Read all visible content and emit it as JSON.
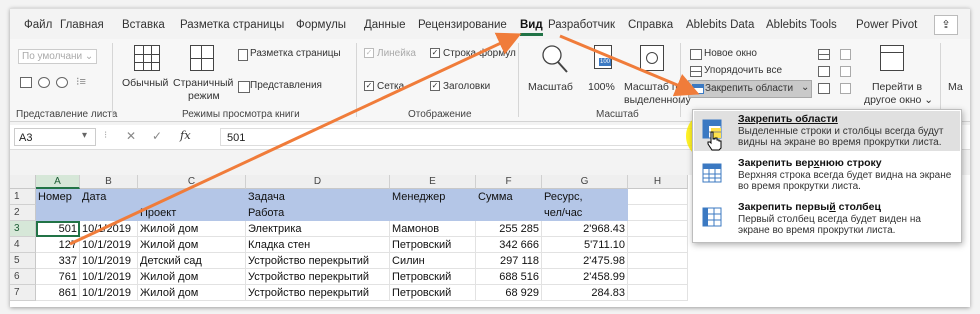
{
  "tabs": [
    "Файл",
    "Главная",
    "Вставка",
    "Разметка страницы",
    "Формулы",
    "Данные",
    "Рецензирование",
    "Вид",
    "Разработчик",
    "Справка",
    "Ablebits Data",
    "Ablebits Tools",
    "Power Pivot"
  ],
  "active_tab": "Вид",
  "ribbon": {
    "sheet_view": {
      "default_label": "По умолчани",
      "group_label": "Представление листа"
    },
    "workbook_views": {
      "normal": "Обычный",
      "page_mode_1": "Страничный",
      "page_mode_2": "режим",
      "page_layout": "Разметка страницы",
      "custom_views": "Представления",
      "group_label": "Режимы просмотра книги"
    },
    "show": {
      "ruler": "Линейка",
      "formula_bar": "Строка формул",
      "gridlines": "Сетка",
      "headings": "Заголовки",
      "group_label": "Отображение"
    },
    "zoom": {
      "zoom": "Масштаб",
      "zoom_100": "100%",
      "zoom_sel_1": "Масштаб по",
      "zoom_sel_2": "выделенному",
      "group_label": "Масштаб"
    },
    "window": {
      "new_window": "Новое окно",
      "arrange_all": "Упорядочить все",
      "freeze_panes": "Закрепить области",
      "switch_1": "Перейти в",
      "switch_2": "другое окно",
      "macros_partial": "Ма"
    }
  },
  "formula_bar": {
    "name_box": "A3",
    "fx": "fx",
    "value": "501"
  },
  "columns": [
    "A",
    "B",
    "C",
    "D",
    "E",
    "F",
    "G",
    "H"
  ],
  "rows": [
    "1",
    "2",
    "3",
    "4",
    "5",
    "6",
    "7"
  ],
  "header_row1": [
    "Номер",
    "Дата",
    "",
    "Задача",
    "Менеджер",
    "Сумма",
    "Ресурс,"
  ],
  "header_row2": [
    "",
    "",
    "Проект",
    "Работа",
    "",
    "",
    "чел/час"
  ],
  "data_rows": [
    [
      "501",
      "10/1/2019",
      "Жилой дом",
      "Электрика",
      "Мамонов",
      "255 285",
      "2'968.43"
    ],
    [
      "127",
      "10/1/2019",
      "Жилой дом",
      "Кладка стен",
      "Петровский",
      "342 666",
      "5'711.10"
    ],
    [
      "337",
      "10/1/2019",
      "Детский сад",
      "Устройство перекрытий",
      "Силин",
      "297 118",
      "2'475.98"
    ],
    [
      "761",
      "10/1/2019",
      "Жилой дом",
      "Устройство перекрытий",
      "Петровский",
      "688 516",
      "2'458.99"
    ],
    [
      "861",
      "10/1/2019",
      "Жилой дом",
      "Устройство перекрытий",
      "Петровский",
      "68 929",
      "284.83"
    ]
  ],
  "dropdown": {
    "freeze_panes": {
      "title": "Закрепить области",
      "desc": "Выделенные строки и столбцы всегда будут видны на экране во время прокрутки листа."
    },
    "freeze_top_row": {
      "title_pre": "Закрепить вер",
      "title_u": "х",
      "title_post": "нюю строку",
      "desc": "Верхняя строка всегда будет видна на экране во время прокрутки листа."
    },
    "freeze_first_col": {
      "title_pre": "Закрепить первы",
      "title_u": "й",
      "title_post": " столбец",
      "desc": "Первый столбец всегда будет виден на экране во время прокрутки листа."
    }
  },
  "colors": {
    "accent": "#217346",
    "header_fill": "#b4c6e7",
    "arrow": "#f07c3a",
    "highlight": "#fff000"
  }
}
